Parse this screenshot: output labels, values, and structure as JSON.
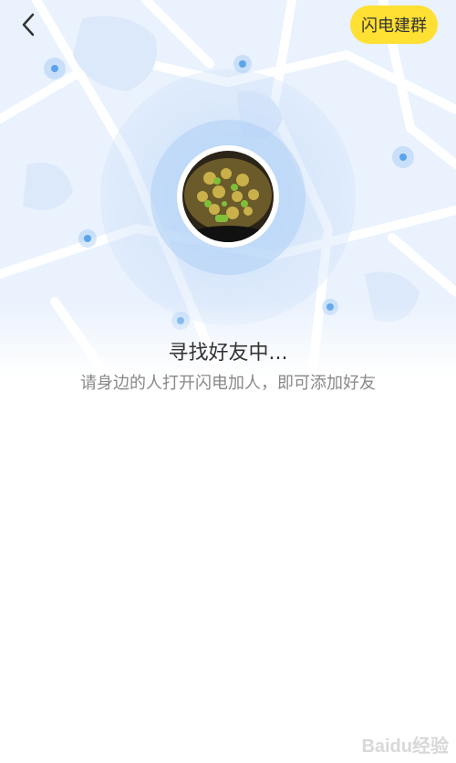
{
  "header": {
    "back_icon": "chevron-left-icon",
    "group_button_label": "闪电建群"
  },
  "status": {
    "title": "寻找好友中...",
    "hint": "请身边的人打开闪电加人，即可添加好友"
  },
  "colors": {
    "accent_yellow": "#FFE033",
    "map_background": "#EAF2FD",
    "radar_blue": "#5BA4EC"
  },
  "watermark": "Baidu经验"
}
